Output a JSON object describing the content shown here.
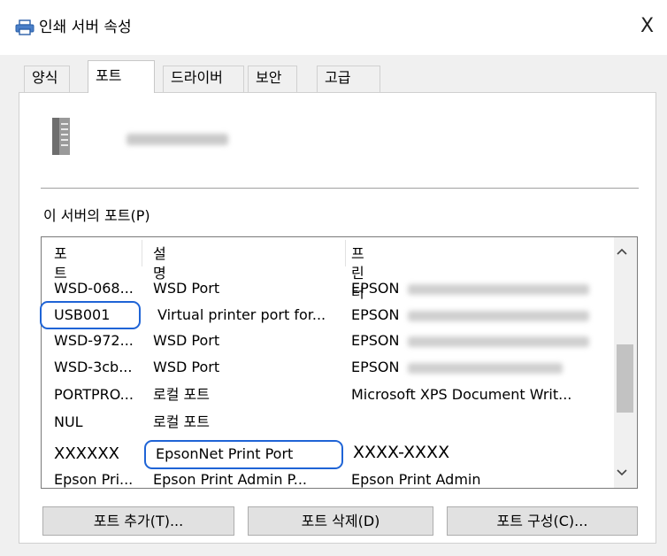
{
  "window": {
    "title": "인쇄 서버 속성",
    "close_glyph": "X"
  },
  "tabs": [
    {
      "label": "양식",
      "active": false
    },
    {
      "label": "포트",
      "active": true
    },
    {
      "label": "드라이버",
      "active": false
    },
    {
      "label": "보안",
      "active": false
    },
    {
      "label": "고급",
      "active": false
    }
  ],
  "section_label": "이 서버의 포트(P)",
  "ports_list": {
    "columns": [
      "포트",
      "설명",
      "프린터"
    ],
    "rows": [
      {
        "port": "WSD-068...",
        "description": "WSD Port",
        "printer": "EPSON"
      },
      {
        "port": "USB001",
        "description": "Virtual printer port for...",
        "printer": "EPSON"
      },
      {
        "port": "WSD-972...",
        "description": "WSD Port",
        "printer": "EPSON"
      },
      {
        "port": "WSD-3cb...",
        "description": "WSD Port",
        "printer": "EPSON"
      },
      {
        "port": "PORTPRO...",
        "description": "로컬 포트",
        "printer": "Microsoft XPS Document Writ..."
      },
      {
        "port": "NUL",
        "description": "로컬 포트",
        "printer": ""
      },
      {
        "port": "XXXXXX",
        "description": "EpsonNet Print Port",
        "printer": "XXXX-XXXX"
      },
      {
        "port": "Epson Pri...",
        "description": "Epson Print Admin P...",
        "printer": "Epson Print Admin"
      }
    ]
  },
  "buttons": {
    "add": "포트 추가(T)...",
    "delete": "포트 삭제(D)",
    "configure": "포트 구성(C)..."
  },
  "colors": {
    "highlight": "#1f64d6",
    "window_bg": "#f0f0f0"
  },
  "icons": [
    "printer-icon",
    "server-icon",
    "close-icon",
    "scroll-up-icon",
    "scroll-down-icon"
  ]
}
